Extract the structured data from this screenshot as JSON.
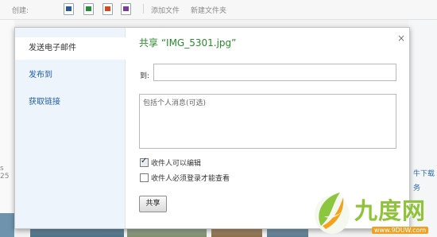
{
  "toolbar": {
    "create_label": "创建:",
    "add_file": "添加文件",
    "new_folder": "新建文件夹",
    "icons": [
      "word-doc-icon",
      "excel-icon",
      "powerpoint-icon",
      "onenote-icon"
    ],
    "icon_colors": [
      "#2b5797",
      "#2a8a3c",
      "#d24726",
      "#7a3b9a"
    ]
  },
  "background": {
    "left_number": "s 25",
    "right_links": [
      "牛下载",
      "务"
    ]
  },
  "dialog": {
    "title": "共享 “IMG_5301.jpg”",
    "close": "×",
    "side_items": [
      "发送电子邮件",
      "发布到",
      "获取链接"
    ],
    "to_label": "到:",
    "to_value": "",
    "message_placeholder": "包括个人消息(可选)",
    "checkbox_edit": {
      "label": "收件人可以编辑",
      "checked": true
    },
    "checkbox_signin": {
      "label": "收件人必须登录才能查看",
      "checked": false
    },
    "share_button": "共享"
  },
  "watermark": {
    "text": "九度网",
    "url": "www.9DUW.com",
    "logo": "leaf-logo-icon"
  }
}
